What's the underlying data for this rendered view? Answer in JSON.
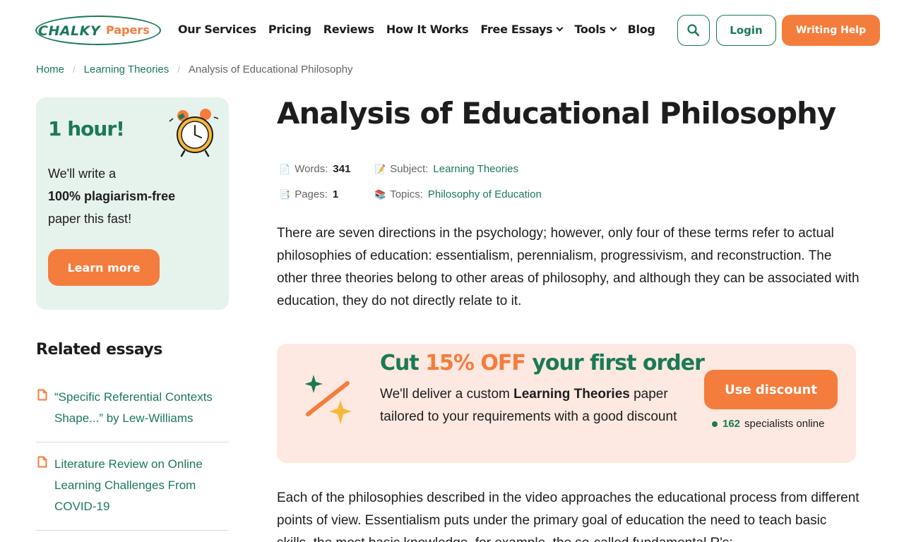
{
  "header": {
    "logo_left": "CHALKY",
    "logo_right": "Papers",
    "nav": [
      {
        "label": "Our Services",
        "has_dropdown": false
      },
      {
        "label": "Pricing",
        "has_dropdown": false
      },
      {
        "label": "Reviews",
        "has_dropdown": false
      },
      {
        "label": "How It Works",
        "has_dropdown": false
      },
      {
        "label": "Free Essays",
        "has_dropdown": true
      },
      {
        "label": "Tools",
        "has_dropdown": true
      },
      {
        "label": "Blog",
        "has_dropdown": false
      }
    ],
    "login_label": "Login",
    "help_label": "Writing Help"
  },
  "breadcrumb": {
    "home": "Home",
    "category": "Learning Theories",
    "current": "Analysis of Educational Philosophy"
  },
  "promo": {
    "title": "1 hour!",
    "line1": "We'll write a",
    "bold": "100% plagiarism-free",
    "line2": "paper this fast!",
    "button": "Learn more"
  },
  "related": {
    "title": "Related essays",
    "items": [
      {
        "title": "“Specific Referential Contexts Shape...” by Lew-Williams"
      },
      {
        "title": "Literature Review on Online Learning Challenges From COVID-19"
      }
    ]
  },
  "article": {
    "title": "Analysis of Educational Philosophy",
    "meta": {
      "words_label": "Words:",
      "words": "341",
      "pages_label": "Pages:",
      "pages": "1",
      "subject_label": "Subject:",
      "subject": "Learning Theories",
      "topics_label": "Topics:",
      "topics": "Philosophy of Education"
    },
    "para1": "There are seven directions in the psychology; however, only four of these terms refer to actual philosophies of education: essentialism, perennialism, progressivism, and reconstruction. The other three theories belong to other areas of philosophy, and although they can be associated with education, they do not directly relate to it.",
    "para2": "Each of the philosophies described in the video approaches the educational process from different points of view. Essentialism puts under the primary goal of education the need to teach basic skills, the most basic knowledge, for example, the so-called fundamental R's:"
  },
  "discount": {
    "title_start": "Cut ",
    "title_highlight": "15% OFF",
    "title_end": " your first order",
    "text_start": "We'll deliver a custom ",
    "text_bold": "Learning Theories",
    "text_end": " paper tailored to your requirements with a good discount",
    "button": "Use discount",
    "online_count": "162",
    "online_label": "specialists online"
  },
  "colors": {
    "brand_green": "#1a7a55",
    "brand_orange": "#f47c3c",
    "promo_bg": "#e6f2ec",
    "discount_bg": "#fde9e1"
  },
  "icons": [
    "search-icon",
    "chevron-down-icon",
    "alarm-clock-icon",
    "document-icon",
    "page-icon",
    "pencil-icon",
    "books-icon",
    "sparkle-wand-icon"
  ]
}
